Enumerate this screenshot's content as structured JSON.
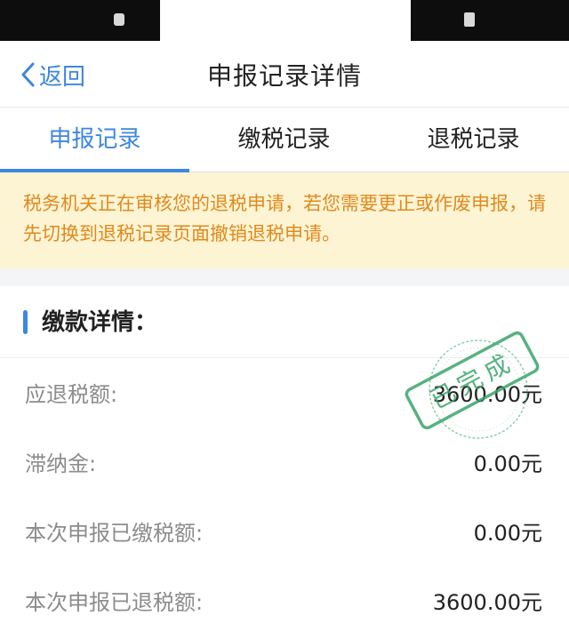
{
  "nav": {
    "back_label": "返回",
    "title": "申报记录详情"
  },
  "tabs": [
    {
      "label": "申报记录",
      "active": true
    },
    {
      "label": "缴税记录",
      "active": false
    },
    {
      "label": "退税记录",
      "active": false
    }
  ],
  "notice": {
    "text": "税务机关正在审核您的退税申请，若您需要更正或作废申报，请先切换到退税记录页面撤销退税申请。"
  },
  "section": {
    "title": "缴款详情：",
    "rows": [
      {
        "label": "应退税额:",
        "value": "3600.00元"
      },
      {
        "label": "滞纳金:",
        "value": "0.00元"
      },
      {
        "label": "本次申报已缴税额:",
        "value": "0.00元"
      },
      {
        "label": "本次申报已退税额:",
        "value": "3600.00元"
      }
    ]
  },
  "stamp": {
    "text": "已完成"
  },
  "colors": {
    "accent": "#3e86e0",
    "notice_bg": "#fdf4d4",
    "notice_text": "#e08a1d",
    "stamp": "#3aa56b"
  }
}
